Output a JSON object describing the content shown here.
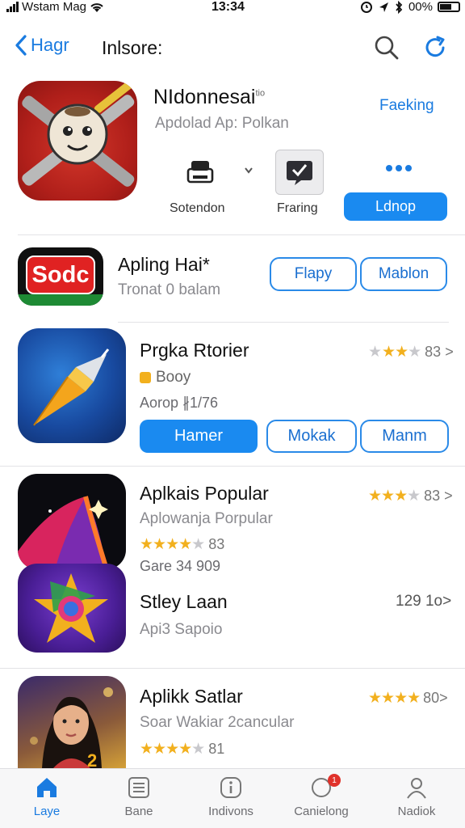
{
  "status_bar": {
    "carrier": "Wstam Mag",
    "time": "13:34",
    "battery": "00%"
  },
  "nav": {
    "back_label": "Hagr",
    "title": "Inlsore:"
  },
  "featured": {
    "title": "NIdonnesai",
    "title_mark": "tio",
    "subtitle": "Apdolad Ap: Polkan",
    "link": "Faeking",
    "actions": [
      {
        "label": "Sotendon",
        "icon": "printer-icon"
      },
      {
        "label": "Fraring",
        "icon": "share-icon"
      },
      {
        "label": "Ldnop",
        "icon": "more-icon"
      }
    ]
  },
  "rows": [
    {
      "logo_text": "Sodc",
      "title": "Apling Hai*",
      "subtitle": "Tronat 0 balam",
      "buttons": [
        "Flapy",
        "Mablon"
      ]
    },
    {
      "title": "Prgka Rtorier",
      "subtitle": "Booy",
      "meta": "Aorop ∦1/76",
      "rating": 3,
      "rating_text": "83 >",
      "buttons": [
        "Hamer",
        "Mokak",
        "Manm"
      ]
    },
    {
      "title": "Aplkais Popular",
      "subtitle": "Aplowanja Porpular",
      "rating": 4,
      "rating_text": "83",
      "meta": "Gare 34 909",
      "side_rating": 3,
      "side_text": "83 >"
    },
    {
      "title": "Stley Laan",
      "subtitle": "Api3 Sapoio",
      "side_text": "129 1o>"
    },
    {
      "title": "Aplikk Satlar",
      "subtitle": "Soar Wakiar 2cancular",
      "rating": 4,
      "rating_text": "81",
      "side_rating": 4,
      "side_text": "80>"
    }
  ],
  "tabbar": [
    {
      "label": "Laye",
      "icon": "home-icon",
      "active": true
    },
    {
      "label": "Bane",
      "icon": "news-icon",
      "active": false
    },
    {
      "label": "Indivons",
      "icon": "info-icon",
      "active": false
    },
    {
      "label": "Canielong",
      "icon": "chat-icon",
      "active": false,
      "badge": "1"
    },
    {
      "label": "Nadiok",
      "icon": "person-icon",
      "active": false
    }
  ],
  "colors": {
    "accent": "#1a7be0",
    "star": "#f2b01e",
    "badge": "#e0322b"
  }
}
